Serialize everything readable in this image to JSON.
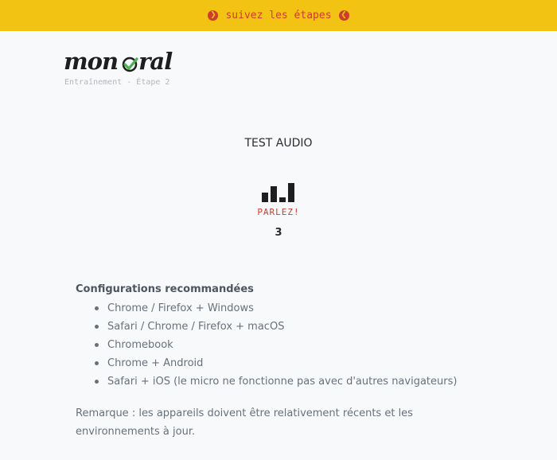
{
  "banner": {
    "label": "suivez les étapes",
    "left_icon": "chevron-circle-right-icon",
    "right_icon": "chevron-circle-left-icon"
  },
  "brand": {
    "logo_part1": "mon",
    "logo_part2": "ral",
    "logo_icon": "check-o-icon",
    "subtitle": "Entraînement - Étape 2"
  },
  "audio_test": {
    "title": "TEST AUDIO",
    "level_icon": "audio-level-icon",
    "prompt": "PARLEZ!",
    "countdown": "3"
  },
  "config": {
    "title": "Configurations recommandées",
    "items": [
      "Chrome / Firefox + Windows",
      "Safari / Chrome / Firefox + macOS",
      "Chromebook",
      "Chrome + Android",
      "Safari + iOS (le micro ne fonctionne pas avec d'autres navigateurs)"
    ]
  },
  "remark": "Remarque : les appareils doivent être relativement récents et les environnements à jour.",
  "colors": {
    "banner_bg": "#f3c313",
    "accent_red": "#cf3b2f",
    "check_green": "#4cb050",
    "page_bg": "#f7f9fb"
  }
}
